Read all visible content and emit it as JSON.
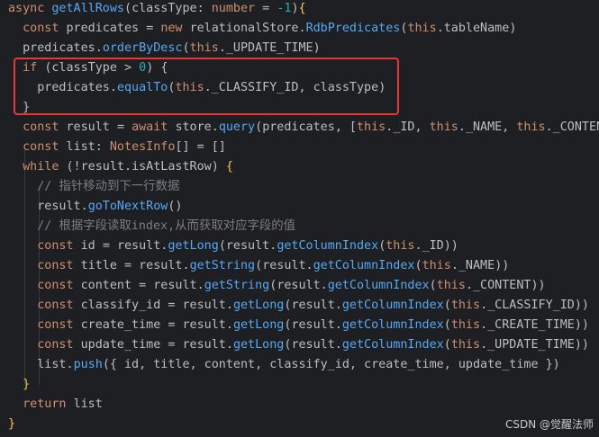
{
  "code": {
    "lines": [
      [
        [
          "kw",
          "async "
        ],
        [
          "fn",
          "getAllRows"
        ],
        [
          "punct",
          "("
        ],
        [
          "param",
          "classType"
        ],
        [
          "punct",
          ": "
        ],
        [
          "kw",
          "number"
        ],
        [
          "punct",
          " = "
        ],
        [
          "num",
          "-1"
        ],
        [
          "punct",
          ")"
        ],
        [
          "brace-y",
          "{"
        ]
      ],
      [
        [
          "plain",
          "  "
        ],
        [
          "kw",
          "const "
        ],
        [
          "plain",
          "predicates "
        ],
        [
          "punct",
          "= "
        ],
        [
          "kw",
          "new "
        ],
        [
          "plain",
          "relationalStore."
        ],
        [
          "fn",
          "RdbPredicates"
        ],
        [
          "punct",
          "("
        ],
        [
          "thiskw",
          "this"
        ],
        [
          "punct",
          "."
        ],
        [
          "plain",
          "tableName"
        ],
        [
          "punct",
          ")"
        ]
      ],
      [
        [
          "plain",
          "  predicates."
        ],
        [
          "fn",
          "orderByDesc"
        ],
        [
          "punct",
          "("
        ],
        [
          "thiskw",
          "this"
        ],
        [
          "punct",
          "."
        ],
        [
          "plain",
          "_UPDATE_TIME"
        ],
        [
          "punct",
          ")"
        ]
      ],
      [
        [
          "plain",
          "  "
        ],
        [
          "kw",
          "if "
        ],
        [
          "punct",
          "("
        ],
        [
          "plain",
          "classType "
        ],
        [
          "punct",
          "> "
        ],
        [
          "num",
          "0"
        ],
        [
          "punct",
          ") "
        ],
        [
          "brace-p",
          "{"
        ]
      ],
      [
        [
          "plain",
          "    predicates."
        ],
        [
          "fn",
          "equalTo"
        ],
        [
          "punct",
          "("
        ],
        [
          "thiskw",
          "this"
        ],
        [
          "punct",
          "."
        ],
        [
          "plain",
          "_CLASSIFY_ID"
        ],
        [
          "punct",
          ", "
        ],
        [
          "plain",
          "classType"
        ],
        [
          "punct",
          ")"
        ]
      ],
      [
        [
          "plain",
          "  "
        ],
        [
          "brace-p",
          "}"
        ]
      ],
      [
        [
          "plain",
          "  "
        ],
        [
          "kw",
          "const "
        ],
        [
          "plain",
          "result "
        ],
        [
          "punct",
          "= "
        ],
        [
          "kw",
          "await "
        ],
        [
          "plain",
          "store."
        ],
        [
          "fn",
          "query"
        ],
        [
          "punct",
          "("
        ],
        [
          "plain",
          "predicates"
        ],
        [
          "punct",
          ", ["
        ],
        [
          "thiskw",
          "this"
        ],
        [
          "punct",
          "."
        ],
        [
          "plain",
          "_ID"
        ],
        [
          "punct",
          ", "
        ],
        [
          "thiskw",
          "this"
        ],
        [
          "punct",
          "."
        ],
        [
          "plain",
          "_NAME"
        ],
        [
          "punct",
          ", "
        ],
        [
          "thiskw",
          "this"
        ],
        [
          "punct",
          "."
        ],
        [
          "plain",
          "_CONTEN"
        ]
      ],
      [
        [
          "plain",
          "  "
        ],
        [
          "kw",
          "const "
        ],
        [
          "plain",
          "list"
        ],
        [
          "punct",
          ": "
        ],
        [
          "kw",
          "NotesInfo"
        ],
        [
          "punct",
          "[] = []"
        ]
      ],
      [
        [
          "plain",
          "  "
        ],
        [
          "kw",
          "while "
        ],
        [
          "punct",
          "(!"
        ],
        [
          "plain",
          "result."
        ],
        [
          "plain",
          "isAtLastRow"
        ],
        [
          "punct",
          ") "
        ],
        [
          "brace-y",
          "{"
        ]
      ],
      [
        [
          "plain",
          "    "
        ],
        [
          "cm",
          "// 指针移动到下一行数据"
        ]
      ],
      [
        [
          "plain",
          "    result."
        ],
        [
          "fn",
          "goToNextRow"
        ],
        [
          "punct",
          "()"
        ]
      ],
      [
        [
          "plain",
          "    "
        ],
        [
          "cm",
          "// 根据字段读取index,从而获取对应字段的值"
        ]
      ],
      [
        [
          "plain",
          "    "
        ],
        [
          "kw",
          "const "
        ],
        [
          "plain",
          "id "
        ],
        [
          "punct",
          "= "
        ],
        [
          "plain",
          "result."
        ],
        [
          "fn",
          "getLong"
        ],
        [
          "punct",
          "("
        ],
        [
          "plain",
          "result."
        ],
        [
          "fn",
          "getColumnIndex"
        ],
        [
          "punct",
          "("
        ],
        [
          "thiskw",
          "this"
        ],
        [
          "punct",
          "."
        ],
        [
          "plain",
          "_ID"
        ],
        [
          "punct",
          "))"
        ]
      ],
      [
        [
          "plain",
          "    "
        ],
        [
          "kw",
          "const "
        ],
        [
          "plain",
          "title "
        ],
        [
          "punct",
          "= "
        ],
        [
          "plain",
          "result."
        ],
        [
          "fn",
          "getString"
        ],
        [
          "punct",
          "("
        ],
        [
          "plain",
          "result."
        ],
        [
          "fn",
          "getColumnIndex"
        ],
        [
          "punct",
          "("
        ],
        [
          "thiskw",
          "this"
        ],
        [
          "punct",
          "."
        ],
        [
          "plain",
          "_NAME"
        ],
        [
          "punct",
          "))"
        ]
      ],
      [
        [
          "plain",
          "    "
        ],
        [
          "kw",
          "const "
        ],
        [
          "plain",
          "content "
        ],
        [
          "punct",
          "= "
        ],
        [
          "plain",
          "result."
        ],
        [
          "fn",
          "getString"
        ],
        [
          "punct",
          "("
        ],
        [
          "plain",
          "result."
        ],
        [
          "fn",
          "getColumnIndex"
        ],
        [
          "punct",
          "("
        ],
        [
          "thiskw",
          "this"
        ],
        [
          "punct",
          "."
        ],
        [
          "plain",
          "_CONTENT"
        ],
        [
          "punct",
          "))"
        ]
      ],
      [
        [
          "plain",
          "    "
        ],
        [
          "kw",
          "const "
        ],
        [
          "plain",
          "classify_id "
        ],
        [
          "punct",
          "= "
        ],
        [
          "plain",
          "result."
        ],
        [
          "fn",
          "getLong"
        ],
        [
          "punct",
          "("
        ],
        [
          "plain",
          "result."
        ],
        [
          "fn",
          "getColumnIndex"
        ],
        [
          "punct",
          "("
        ],
        [
          "thiskw",
          "this"
        ],
        [
          "punct",
          "."
        ],
        [
          "plain",
          "_CLASSIFY_ID"
        ],
        [
          "punct",
          "))"
        ]
      ],
      [
        [
          "plain",
          "    "
        ],
        [
          "kw",
          "const "
        ],
        [
          "plain",
          "create_time "
        ],
        [
          "punct",
          "= "
        ],
        [
          "plain",
          "result."
        ],
        [
          "fn",
          "getLong"
        ],
        [
          "punct",
          "("
        ],
        [
          "plain",
          "result."
        ],
        [
          "fn",
          "getColumnIndex"
        ],
        [
          "punct",
          "("
        ],
        [
          "thiskw",
          "this"
        ],
        [
          "punct",
          "."
        ],
        [
          "plain",
          "_CREATE_TIME"
        ],
        [
          "punct",
          "))"
        ]
      ],
      [
        [
          "plain",
          "    "
        ],
        [
          "kw",
          "const "
        ],
        [
          "plain",
          "update_time "
        ],
        [
          "punct",
          "= "
        ],
        [
          "plain",
          "result."
        ],
        [
          "fn",
          "getLong"
        ],
        [
          "punct",
          "("
        ],
        [
          "plain",
          "result."
        ],
        [
          "fn",
          "getColumnIndex"
        ],
        [
          "punct",
          "("
        ],
        [
          "thiskw",
          "this"
        ],
        [
          "punct",
          "."
        ],
        [
          "plain",
          "_UPDATE_TIME"
        ],
        [
          "punct",
          "))"
        ]
      ],
      [
        [
          "plain",
          "    list."
        ],
        [
          "fn",
          "push"
        ],
        [
          "punct",
          "({ "
        ],
        [
          "plain",
          "id, title, content, classify_id, create_time, update_time "
        ],
        [
          "punct",
          "})"
        ]
      ],
      [
        [
          "plain",
          "  "
        ],
        [
          "brace-y",
          "}"
        ]
      ],
      [
        [
          "plain",
          "  "
        ],
        [
          "kw",
          "return "
        ],
        [
          "plain",
          "list"
        ]
      ],
      [
        [
          "brace-y",
          "}"
        ]
      ]
    ]
  },
  "watermark": "CSDN @觉醒法师",
  "colors": {
    "background": "#1e1f22",
    "keyword": "#cf8e6d",
    "function": "#56a8f5",
    "number": "#2aacb8",
    "comment": "#7a7e85",
    "highlight_box": "#e53935"
  }
}
